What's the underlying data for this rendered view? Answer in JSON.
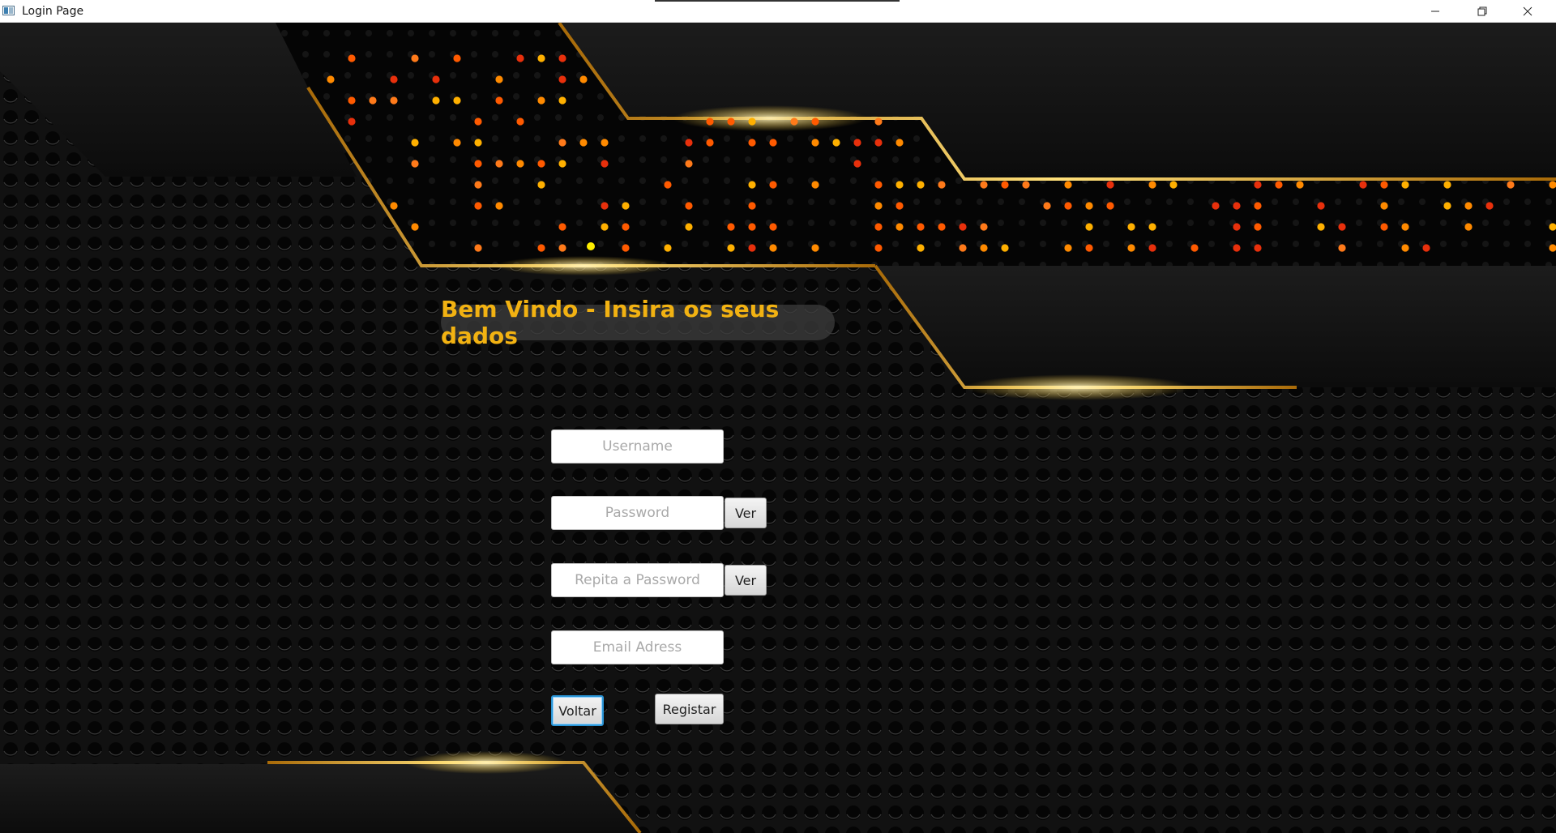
{
  "window": {
    "title": "Login Page",
    "controls": {
      "minimize": "minimize-icon",
      "maximize": "restore-icon",
      "close": "close-icon"
    }
  },
  "form": {
    "heading": "Bem Vindo - Insira os seus dados",
    "username_placeholder": "Username",
    "password_placeholder": "Password",
    "repeat_password_placeholder": "Repita a Password",
    "email_placeholder": "Email Adress",
    "show_password_label": "Ver",
    "show_repeat_password_label": "Ver",
    "back_label": "Voltar",
    "register_label": "Registar"
  },
  "theme": {
    "heading_color": "#f2b212",
    "accent_gold": "#ffcc33",
    "background": "#0b0b0b"
  }
}
